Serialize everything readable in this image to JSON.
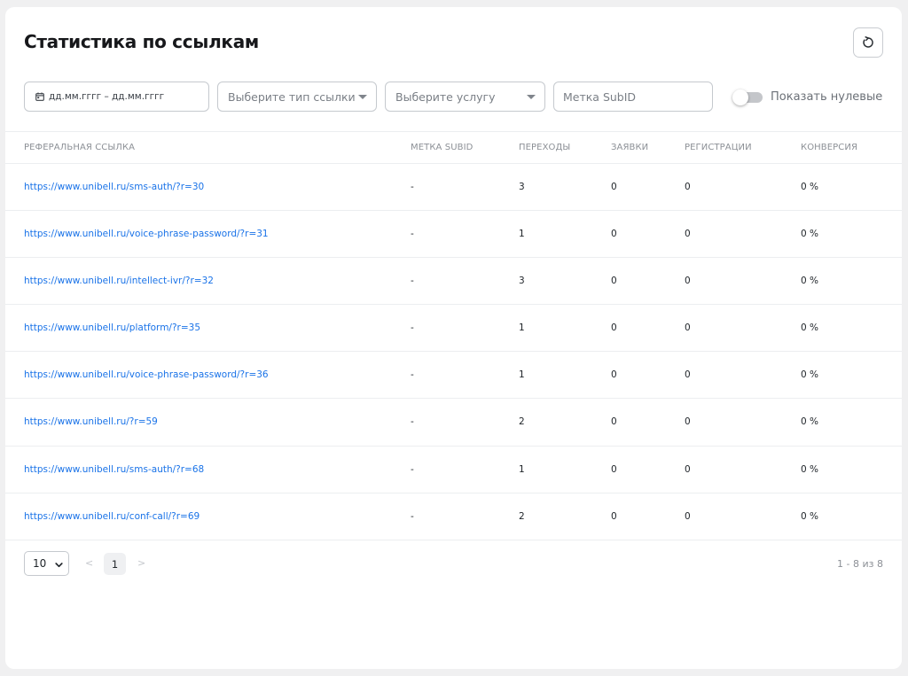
{
  "page": {
    "title": "Статистика по ссылкам"
  },
  "filters": {
    "date_placeholder": "дд.мм.гггг – дд.мм.гггг",
    "link_type_placeholder": "Выберите тип ссылки",
    "service_placeholder": "Выберите услугу",
    "subid_placeholder": "Метка SubID",
    "show_zero_label": "Показать нулевые",
    "show_zero_enabled": false
  },
  "table": {
    "columns": {
      "link": "Реферальная ссылка",
      "subid": "Метка SubID",
      "clicks": "Переходы",
      "orders": "Заявки",
      "registrations": "Регистрации",
      "conversion": "Конверсия"
    },
    "rows": [
      {
        "link": "https://www.unibell.ru/sms-auth/?r=30",
        "subid": "-",
        "clicks": "3",
        "orders": "0",
        "registrations": "0",
        "conversion": "0 %"
      },
      {
        "link": "https://www.unibell.ru/voice-phrase-password/?r=31",
        "subid": "-",
        "clicks": "1",
        "orders": "0",
        "registrations": "0",
        "conversion": "0 %"
      },
      {
        "link": "https://www.unibell.ru/intellect-ivr/?r=32",
        "subid": "-",
        "clicks": "3",
        "orders": "0",
        "registrations": "0",
        "conversion": "0 %"
      },
      {
        "link": "https://www.unibell.ru/platform/?r=35",
        "subid": "-",
        "clicks": "1",
        "orders": "0",
        "registrations": "0",
        "conversion": "0 %"
      },
      {
        "link": "https://www.unibell.ru/voice-phrase-password/?r=36",
        "subid": "-",
        "clicks": "1",
        "orders": "0",
        "registrations": "0",
        "conversion": "0 %"
      },
      {
        "link": "https://www.unibell.ru/?r=59",
        "subid": "-",
        "clicks": "2",
        "orders": "0",
        "registrations": "0",
        "conversion": "0 %"
      },
      {
        "link": "https://www.unibell.ru/sms-auth/?r=68",
        "subid": "-",
        "clicks": "1",
        "orders": "0",
        "registrations": "0",
        "conversion": "0 %"
      },
      {
        "link": "https://www.unibell.ru/conf-call/?r=69",
        "subid": "-",
        "clicks": "2",
        "orders": "0",
        "registrations": "0",
        "conversion": "0 %"
      }
    ]
  },
  "pagination": {
    "page_size": "10",
    "prev": "<",
    "current_page": "1",
    "next": ">",
    "range_text": "1 - 8 из 8"
  },
  "colors": {
    "link": "#1a73e8",
    "background": "#f0f0f1",
    "card": "#ffffff"
  },
  "icons": {
    "refresh": "refresh-icon",
    "calendar": "calendar-icon",
    "dropdown": "chevron-down-icon"
  }
}
